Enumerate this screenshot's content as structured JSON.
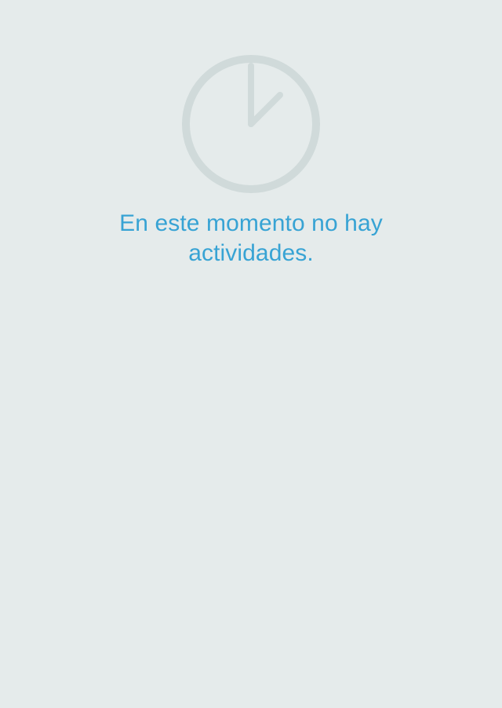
{
  "empty_state": {
    "icon": "clock-icon",
    "message": "En este momento no hay actividades."
  },
  "colors": {
    "background": "#e5ebeb",
    "message": "#37a3d4",
    "icon": "#d0dada"
  }
}
